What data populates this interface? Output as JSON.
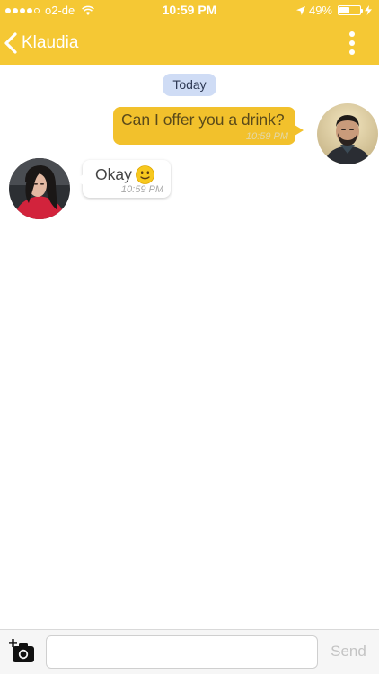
{
  "status_bar": {
    "carrier": "o2-de",
    "time": "10:59 PM",
    "battery_percent": "49%",
    "battery_level": 0.49,
    "signal_bars_filled": 4,
    "signal_bars_total": 5
  },
  "header": {
    "title": "Klaudia",
    "background_color": "#f5c834"
  },
  "chat": {
    "date_divider": "Today",
    "messages": [
      {
        "direction": "outgoing",
        "text": "Can I offer you a drink?",
        "time": "10:59 PM"
      },
      {
        "direction": "incoming",
        "text": "Okay",
        "emoji": "slightly-smiling-face-icon",
        "time": "10:59 PM"
      }
    ]
  },
  "composer": {
    "placeholder": "",
    "value": "",
    "send_label": "Send"
  },
  "colors": {
    "accent": "#f5c834",
    "outgoing_bubble": "#f2c12c",
    "incoming_bubble": "#ffffff",
    "date_pill": "#cfdcf5"
  }
}
